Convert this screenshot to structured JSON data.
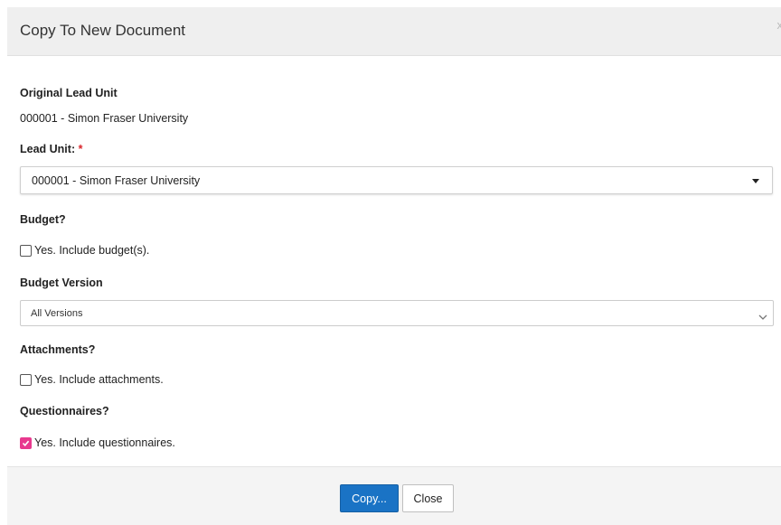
{
  "dialog": {
    "title": "Copy To New Document",
    "close_glyph": "x"
  },
  "original_lead_unit": {
    "label": "Original Lead Unit",
    "value": "000001 - Simon Fraser University"
  },
  "lead_unit": {
    "label": "Lead Unit:",
    "required_mark": "*",
    "selected": "000001 - Simon Fraser University"
  },
  "budget": {
    "label": "Budget?",
    "checkbox_label": "Yes. Include budget(s).",
    "checked": false
  },
  "budget_version": {
    "label": "Budget Version",
    "selected": "All Versions"
  },
  "attachments": {
    "label": "Attachments?",
    "checkbox_label": "Yes. Include attachments.",
    "checked": false
  },
  "questionnaires": {
    "label": "Questionnaires?",
    "checkbox_label": "Yes. Include questionnaires.",
    "checked": true
  },
  "footer": {
    "copy_label": "Copy...",
    "close_label": "Close"
  },
  "colors": {
    "primary_button": "#1a73c5",
    "checkbox_checked": "#e8398e",
    "required": "#d9262c",
    "header_bg": "#efefef"
  }
}
